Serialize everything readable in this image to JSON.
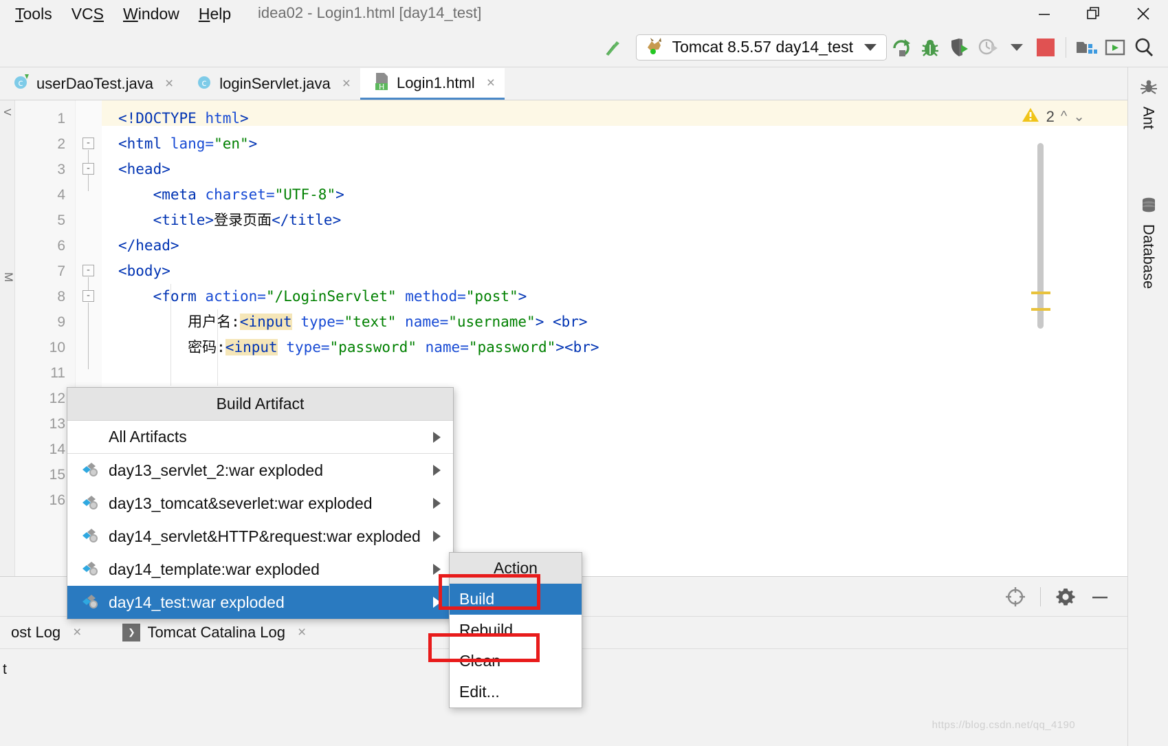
{
  "window": {
    "title": "idea02 - Login1.html [day14_test]",
    "controls": {
      "minimize": "minimize-icon",
      "restore": "restore-icon",
      "close": "close-icon"
    }
  },
  "menubar": {
    "items": [
      {
        "label": "Tools",
        "mnemonic": "T"
      },
      {
        "label": "VCS",
        "mnemonic": "S"
      },
      {
        "label": "Window",
        "mnemonic": "W"
      },
      {
        "label": "Help",
        "mnemonic": "H"
      }
    ]
  },
  "toolbar": {
    "build_icon": "build-hammer-icon",
    "run_config": {
      "label": "Tomcat 8.5.57 day14_test",
      "icon": "tomcat-cat-icon",
      "dropdown": "chevron-down-icon"
    },
    "actions": [
      {
        "name": "rerun-icon",
        "color": "#4a9b4a"
      },
      {
        "name": "debug-bug-icon",
        "color": "#4a9b4a"
      },
      {
        "name": "run-with-coverage-icon",
        "color": "#5b5b5b"
      },
      {
        "name": "profiler-icon",
        "color": "#b4b4b4"
      },
      {
        "name": "stop-icon",
        "color": "#e05252"
      },
      {
        "name": "project-structure-icon",
        "color": "#6e6e6e"
      },
      {
        "name": "run-anything-icon",
        "color": "#6e6e6e"
      },
      {
        "name": "search-everywhere-icon",
        "color": "#3a3a3a"
      }
    ]
  },
  "editor_tabs": [
    {
      "label": "userDaoTest.java",
      "icon": "java-test-class-icon",
      "active": false,
      "close": "×"
    },
    {
      "label": "loginServlet.java",
      "icon": "java-class-icon",
      "active": false,
      "close": "×"
    },
    {
      "label": "Login1.html",
      "icon": "html-file-icon",
      "active": true,
      "close": "×"
    }
  ],
  "editor": {
    "left_rail_label": "V",
    "warning_count": "2",
    "warning_icon": "warning-triangle-icon",
    "lines": [
      {
        "n": "1",
        "tokens": [
          {
            "t": "<!DOCTYPE ",
            "c": "tag"
          },
          {
            "t": "html",
            "c": "attr"
          },
          {
            "t": ">",
            "c": "tag"
          }
        ]
      },
      {
        "n": "2",
        "tokens": [
          {
            "t": "<html ",
            "c": "tag"
          },
          {
            "t": "lang=",
            "c": "attr"
          },
          {
            "t": "\"en\"",
            "c": "val"
          },
          {
            "t": ">",
            "c": "tag"
          }
        ]
      },
      {
        "n": "3",
        "tokens": [
          {
            "t": "<head>",
            "c": "tag"
          }
        ]
      },
      {
        "n": "4",
        "tokens": [
          {
            "t": "    <meta ",
            "c": "tag"
          },
          {
            "t": "charset=",
            "c": "attr"
          },
          {
            "t": "\"UTF-8\"",
            "c": "val"
          },
          {
            "t": ">",
            "c": "tag"
          }
        ]
      },
      {
        "n": "5",
        "tokens": [
          {
            "t": "    <title>",
            "c": "tag"
          },
          {
            "t": "登录页面",
            "c": "txt"
          },
          {
            "t": "</title>",
            "c": "tag"
          }
        ]
      },
      {
        "n": "6",
        "tokens": [
          {
            "t": "</head>",
            "c": "tag"
          }
        ]
      },
      {
        "n": "7",
        "tokens": [
          {
            "t": "<body>",
            "c": "tag"
          }
        ]
      },
      {
        "n": "8",
        "tokens": [
          {
            "t": "    <form ",
            "c": "tag"
          },
          {
            "t": "action=",
            "c": "attr"
          },
          {
            "t": "\"/LoginServlet\"",
            "c": "val"
          },
          {
            "t": " ",
            "c": "txt"
          },
          {
            "t": "method=",
            "c": "attr"
          },
          {
            "t": "\"post\"",
            "c": "val"
          },
          {
            "t": ">",
            "c": "tag"
          }
        ]
      },
      {
        "n": "9",
        "tokens": [
          {
            "t": "        用户名:",
            "c": "txt"
          },
          {
            "t": "<input",
            "c": "tag hl"
          },
          {
            "t": " ",
            "c": "txt"
          },
          {
            "t": "type=",
            "c": "attr"
          },
          {
            "t": "\"text\"",
            "c": "val"
          },
          {
            "t": " ",
            "c": "txt"
          },
          {
            "t": "name=",
            "c": "attr"
          },
          {
            "t": "\"username\"",
            "c": "val"
          },
          {
            "t": "> ",
            "c": "tag"
          },
          {
            "t": "<br>",
            "c": "tag"
          }
        ]
      },
      {
        "n": "10",
        "tokens": [
          {
            "t": "        密码:",
            "c": "txt"
          },
          {
            "t": "<input",
            "c": "tag hl"
          },
          {
            "t": " ",
            "c": "txt"
          },
          {
            "t": "type=",
            "c": "attr"
          },
          {
            "t": "\"password\"",
            "c": "val"
          },
          {
            "t": " ",
            "c": "txt"
          },
          {
            "t": "name=",
            "c": "attr"
          },
          {
            "t": "\"password\"",
            "c": "val"
          },
          {
            "t": ">",
            "c": "tag"
          },
          {
            "t": "<br>",
            "c": "tag"
          }
        ]
      },
      {
        "n": "11",
        "tokens": []
      },
      {
        "n": "12",
        "tokens": []
      },
      {
        "n": "13",
        "tokens": []
      },
      {
        "n": "14",
        "tokens": []
      },
      {
        "n": "15",
        "tokens": []
      },
      {
        "n": "16",
        "tokens": []
      }
    ]
  },
  "right_rail": {
    "tabs": [
      {
        "label": "Ant",
        "icon": "ant-spider-icon"
      },
      {
        "label": "Database",
        "icon": "database-cylinder-icon"
      }
    ]
  },
  "popup": {
    "title": "Build Artifact",
    "all_artifacts": {
      "label": "All Artifacts",
      "arrow": "chevron-right-icon"
    },
    "artifacts": [
      {
        "label": "day13_servlet_2:war exploded",
        "icon": "artifact-icon",
        "selected": false
      },
      {
        "label": "day13_tomcat&severlet:war exploded",
        "icon": "artifact-icon",
        "selected": false
      },
      {
        "label": "day14_servlet&HTTP&request:war exploded",
        "icon": "artifact-icon",
        "selected": false
      },
      {
        "label": "day14_template:war exploded",
        "icon": "artifact-icon",
        "selected": false
      },
      {
        "label": "day14_test:war exploded",
        "icon": "artifact-icon",
        "selected": true
      }
    ]
  },
  "submenu": {
    "title": "Action",
    "items": [
      {
        "label": "Build",
        "selected": true
      },
      {
        "label": "Rebuild",
        "selected": false
      },
      {
        "label": "Clean",
        "selected": false
      },
      {
        "label": "Edit...",
        "selected": false
      }
    ]
  },
  "tool_window": {
    "header_icons": [
      {
        "name": "scroll-to-source-icon"
      },
      {
        "name": "settings-gear-icon"
      },
      {
        "name": "hide-window-icon"
      }
    ],
    "tabs": [
      {
        "label": "ost Log",
        "icon": "",
        "close": "×"
      },
      {
        "label": "Tomcat Catalina Log",
        "icon": "console-icon",
        "close": "×"
      }
    ],
    "content_text": "t"
  },
  "watermark": "https://blog.csdn.net/qq_4190",
  "colors": {
    "accent_selection": "#2a7ac0",
    "annotation_red": "#e81b1b",
    "warning_yellow": "#f0c419",
    "tag_blue": "#0033b3",
    "value_green": "#008000",
    "stop_red": "#e05252",
    "run_green": "#4a9b4a"
  }
}
